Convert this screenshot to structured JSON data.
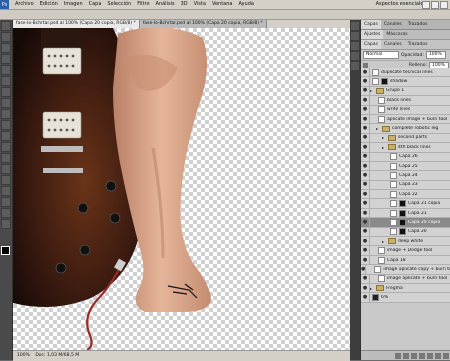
{
  "menubar": {
    "logo": "Ps",
    "items": [
      "Archivo",
      "Edición",
      "Imagen",
      "Capa",
      "Selección",
      "Filtro",
      "Análisis",
      "3D",
      "Vista",
      "Ventana",
      "Ayuda"
    ],
    "workspace": "Aspectos esenciales"
  },
  "document": {
    "tabs": [
      "fase-lo-Bchrtar.psd al 100% (Capa 20 copia, RGB/8) *",
      "fase-lo-Bchrtar.psd al 100% (Capa 20 copia, RGB/8) *"
    ]
  },
  "status": {
    "zoom": "100%",
    "doc_size": "Doc: 1,03 M/68,5 M"
  },
  "layers_panel": {
    "top_tabs": [
      "Capas",
      "Canales",
      "Trazados"
    ],
    "tabs2": [
      "Ajustes",
      "Máscaras"
    ],
    "tabs3": [
      "Capas",
      "Canales",
      "Trazados"
    ],
    "blend_mode": "Normal",
    "opacity_label": "Opacidad:",
    "opacity_value": "100%",
    "fill_label": "Relleno:",
    "fill_value": "100%",
    "layers": [
      {
        "name": "duplicate tecnical lines",
        "type": "layer",
        "indent": 0
      },
      {
        "name": "shadow",
        "type": "layer-mask",
        "indent": 0
      },
      {
        "name": "Grupo 1",
        "type": "folder",
        "indent": 0
      },
      {
        "name": "black lines",
        "type": "layer",
        "indent": 1
      },
      {
        "name": "write lines",
        "type": "layer",
        "indent": 1
      },
      {
        "name": "aplicate image + burn tool",
        "type": "layer",
        "indent": 1
      },
      {
        "name": "complete robotic leg",
        "type": "folder",
        "indent": 1
      },
      {
        "name": "second parts",
        "type": "folder",
        "indent": 2
      },
      {
        "name": "4th black lines",
        "type": "folder",
        "indent": 2
      },
      {
        "name": "Capa 26",
        "type": "layer",
        "indent": 3
      },
      {
        "name": "Capa 25",
        "type": "layer",
        "indent": 3
      },
      {
        "name": "Capa 24",
        "type": "layer",
        "indent": 3
      },
      {
        "name": "Capa 23",
        "type": "layer",
        "indent": 3
      },
      {
        "name": "Capa 22",
        "type": "layer",
        "indent": 3
      },
      {
        "name": "Capa 21 copia",
        "type": "layer-mask",
        "indent": 3
      },
      {
        "name": "Capa 21",
        "type": "layer-mask",
        "indent": 3
      },
      {
        "name": "Capa 20 copia",
        "type": "layer-mask",
        "indent": 3,
        "selected": true
      },
      {
        "name": "Capa 20",
        "type": "layer-mask",
        "indent": 3
      },
      {
        "name": "deep white",
        "type": "folder",
        "indent": 2
      },
      {
        "name": "image + Dodge tool",
        "type": "layer",
        "indent": 1
      },
      {
        "name": "Capa 18",
        "type": "layer",
        "indent": 1
      },
      {
        "name": "image aplicate copy + burn tool",
        "type": "layer",
        "indent": 1
      },
      {
        "name": "image aplicate + burn tool",
        "type": "layer",
        "indent": 1
      },
      {
        "name": "Fregma",
        "type": "folder",
        "indent": 0
      },
      {
        "name": "6%",
        "type": "layer-dark",
        "indent": 0
      }
    ]
  },
  "colors": {
    "guitar_body": "#3a1a10",
    "skin": "#d9a58a",
    "cable": "#a02828"
  }
}
